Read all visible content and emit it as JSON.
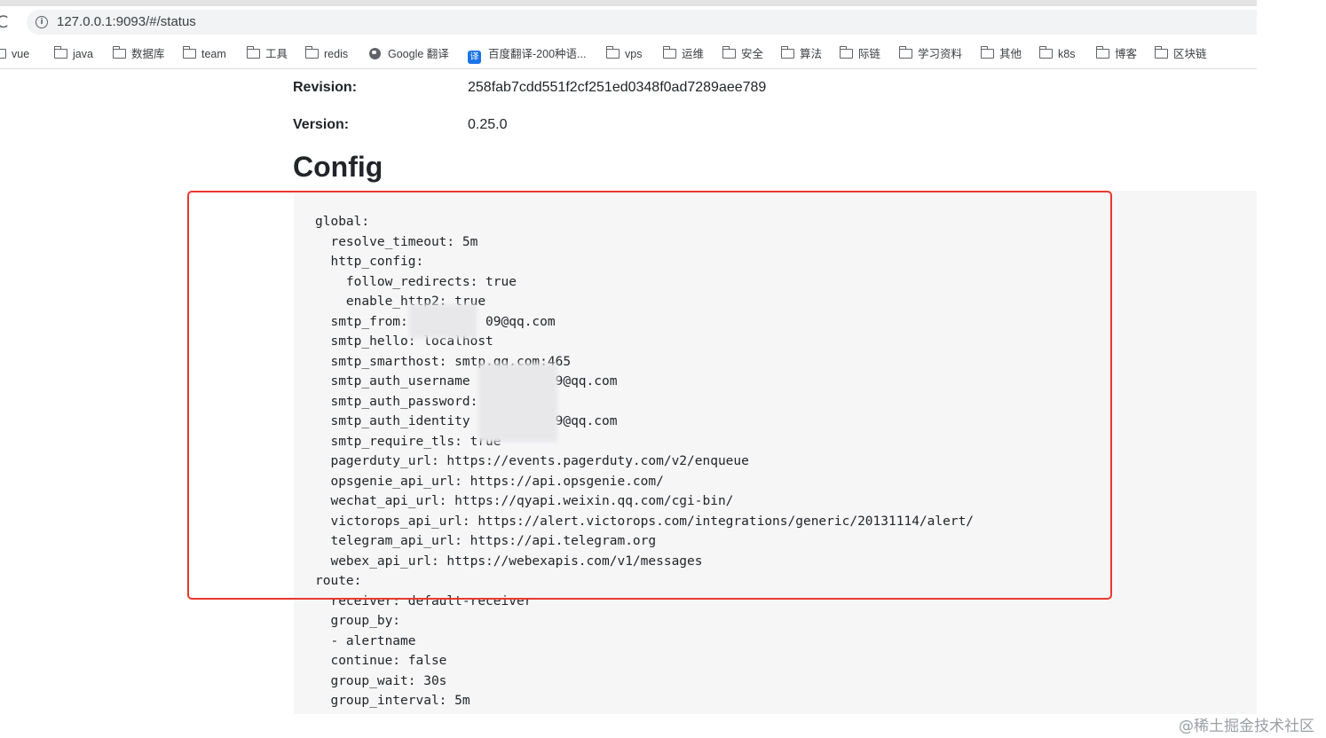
{
  "browser": {
    "url": "127.0.0.1:9093/#/status",
    "reload_glyph": "C",
    "info_glyph": "i",
    "bookmarks": [
      {
        "label": "vue",
        "icon": "folder-icon"
      },
      {
        "label": "java",
        "icon": "folder-icon"
      },
      {
        "label": "数据库",
        "icon": "folder-icon"
      },
      {
        "label": "team",
        "icon": "folder-icon"
      },
      {
        "label": "工具",
        "icon": "folder-icon"
      },
      {
        "label": "redis",
        "icon": "folder-icon"
      },
      {
        "label": "Google 翻译",
        "icon": "globe-icon"
      },
      {
        "label": "百度翻译-200种语...",
        "icon": "translate-icon"
      },
      {
        "label": "vps",
        "icon": "folder-icon"
      },
      {
        "label": "运维",
        "icon": "folder-icon"
      },
      {
        "label": "安全",
        "icon": "folder-icon"
      },
      {
        "label": "算法",
        "icon": "folder-icon"
      },
      {
        "label": "际链",
        "icon": "folder-icon"
      },
      {
        "label": "学习资料",
        "icon": "folder-icon"
      },
      {
        "label": "其他",
        "icon": "folder-icon"
      },
      {
        "label": "k8s",
        "icon": "folder-icon"
      },
      {
        "label": "博客",
        "icon": "folder-icon"
      },
      {
        "label": "区块链",
        "icon": "folder-icon"
      }
    ],
    "translate_glyph": "译"
  },
  "build_info": {
    "revision_label": "Revision:",
    "revision_value": "258fab7cdd551f2cf251ed0348f0ad7289aee789",
    "version_label": "Version:",
    "version_value": "0.25.0"
  },
  "config": {
    "title": "Config",
    "yaml": "global:\n  resolve_timeout: 5m\n  http_config:\n    follow_redirects: true\n    enable_http2: true\n  smtp_from:          09@qq.com\n  smtp_hello: localhost\n  smtp_smarthost: smtp.qq.com:465\n  smtp_auth_username           9@qq.com\n  smtp_auth_password: <secret>\n  smtp_auth_identity           9@qq.com\n  smtp_require_tls: true\n  pagerduty_url: https://events.pagerduty.com/v2/enqueue\n  opsgenie_api_url: https://api.opsgenie.com/\n  wechat_api_url: https://qyapi.weixin.qq.com/cgi-bin/\n  victorops_api_url: https://alert.victorops.com/integrations/generic/20131114/alert/\n  telegram_api_url: https://api.telegram.org\n  webex_api_url: https://webexapis.com/v1/messages\nroute:\n  receiver: default-receiver\n  group_by:\n  - alertname\n  continue: false\n  group_wait: 30s\n  group_interval: 5m"
  },
  "watermark": "@稀土掘金技术社区",
  "colors": {
    "highlight": "#e9392e",
    "code_background": "#f6f6f7"
  }
}
